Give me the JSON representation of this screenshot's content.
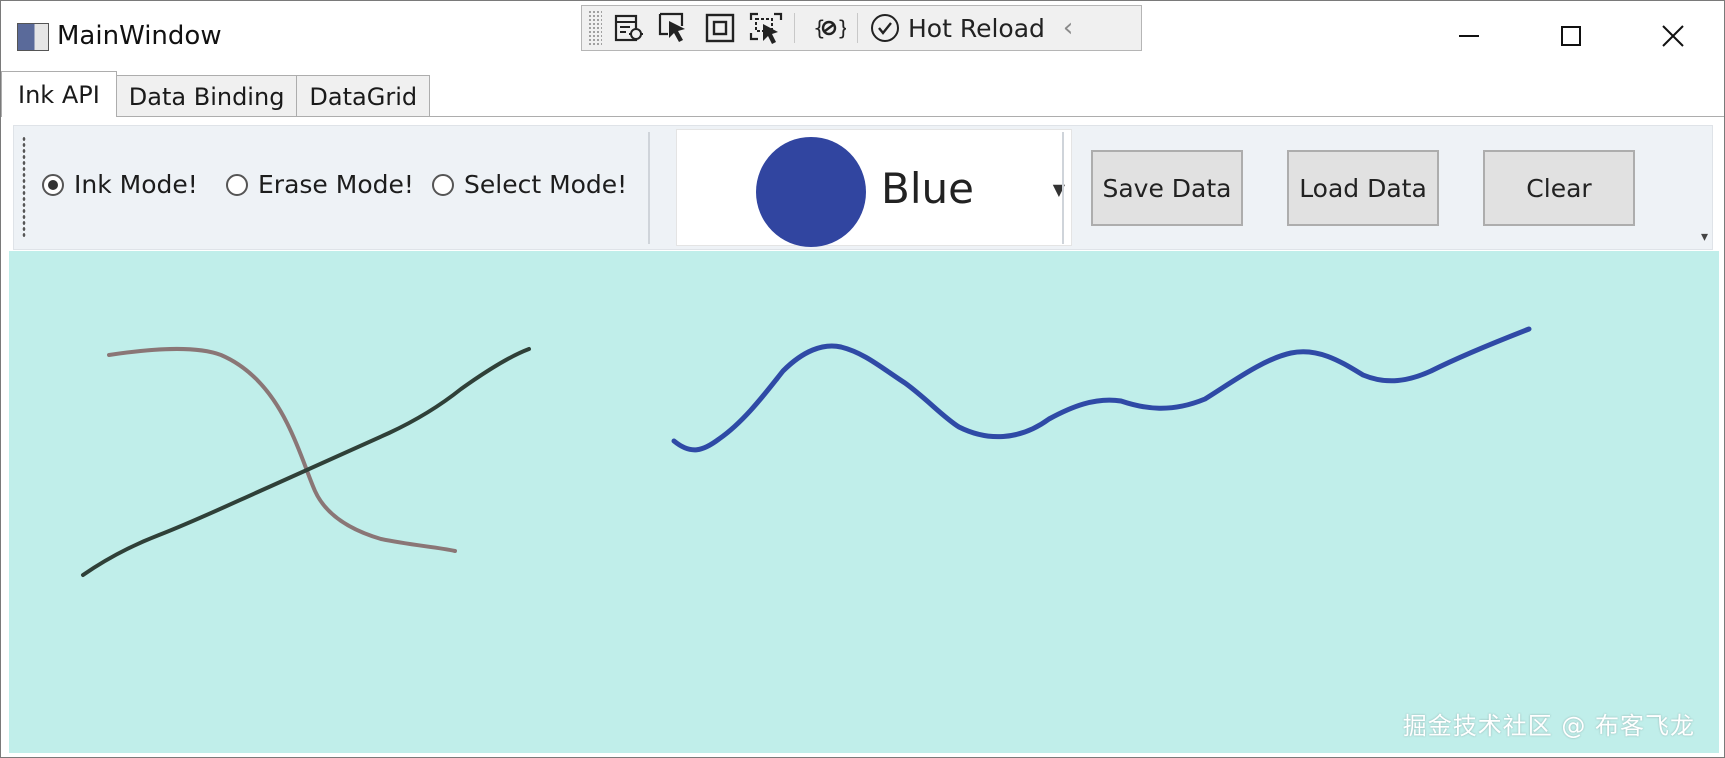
{
  "window": {
    "title": "MainWindow"
  },
  "xaml_toolbar": {
    "hot_reload_label": "Hot Reload"
  },
  "tabs": [
    {
      "label": "Ink API",
      "active": true
    },
    {
      "label": "Data Binding",
      "active": false
    },
    {
      "label": "DataGrid",
      "active": false
    }
  ],
  "modes": [
    {
      "label": "Ink Mode!",
      "checked": true
    },
    {
      "label": "Erase Mode!",
      "checked": false
    },
    {
      "label": "Select Mode!",
      "checked": false
    }
  ],
  "color_picker": {
    "selected_label": "Blue",
    "selected_color": "#3145a0"
  },
  "buttons": {
    "save": "Save Data",
    "load": "Load Data",
    "clear": "Clear"
  },
  "canvas": {
    "background": "#c0eeea",
    "stroke_colors": [
      "#8a7676",
      "#2f4038",
      "#2f4aa6"
    ]
  },
  "watermark": "掘金技术社区 @ 布客飞龙"
}
